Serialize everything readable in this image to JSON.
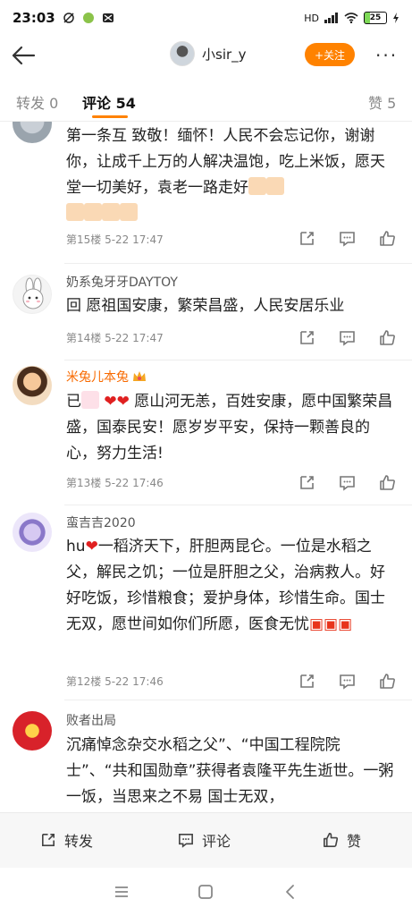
{
  "status": {
    "time": "23:03",
    "battery": "25",
    "signal": "HD"
  },
  "header": {
    "username": "小sir_y",
    "follow_label": "+关注",
    "more": "···"
  },
  "tabs": {
    "repost": "转发 0",
    "comment": "评论 54",
    "like": "赞 5"
  },
  "comments": [
    {
      "name": "",
      "text": "第一条互 致敬！缅怀！人民不会忘记你，谢谢你，让成千上万的人解决温饱，吃上米饭，愿天堂一切美好，袁老一路走好",
      "meta": "第15楼 5-22 17:47"
    },
    {
      "name": "奶系兔牙牙DAYTOY",
      "text": "回  愿祖国安康，繁荣昌盛，人民安居乐业",
      "meta": "第14楼 5-22 17:47"
    },
    {
      "name": "米兔儿本兔",
      "text_a": "已",
      "text_b": " 愿山河无恙，百姓安康，愿中国繁荣昌盛，国泰民安！愿岁岁平安，保持一颗善良的心，努力生活!",
      "meta": "第13楼 5-22 17:46"
    },
    {
      "name": "蛮吉吉2020",
      "text_a": "hu",
      "text_b": "一稻济天下，肝胆两昆仑。一位是水稻之父，解民之饥；一位是肝胆之父，治病救人。好好吃饭，珍惜粮食；爱护身体，珍惜生命。国士无双，愿世间如你们所愿，医食无忧",
      "meta": "第12楼 5-22 17:46"
    },
    {
      "name": "败者出局",
      "text": "沉痛悼念杂交水稻之父”、“中国工程院院士”、“共和国勋章”获得者袁隆平先生逝世。一粥一饭，当思来之不易 国士无双，",
      "meta": ""
    }
  ],
  "bottom_bar": {
    "repost": "转发",
    "comment": "评论",
    "like": "赞"
  },
  "colors": {
    "accent": "#ff8200",
    "vip_name": "#f86a00"
  },
  "icons": [
    "back-arrow-icon",
    "share-icon",
    "comment-icon",
    "like-icon",
    "menu-icon",
    "home-icon",
    "back-icon"
  ]
}
